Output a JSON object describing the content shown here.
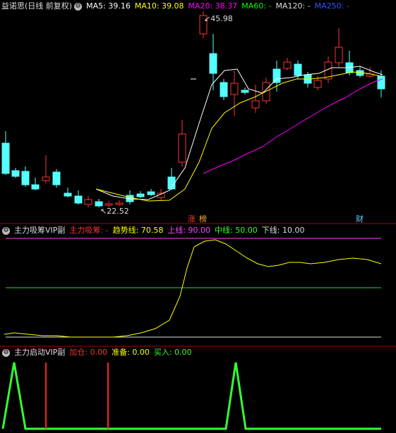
{
  "main_header": {
    "stock_name": "益诺思",
    "period": "(日线 前复权)",
    "ma5_label": "MA5:",
    "ma5_value": "39.16",
    "ma10_label": "MA10:",
    "ma10_value": "39.08",
    "ma20_label": "MA20:",
    "ma20_value": "38.37",
    "ma60_label": "MA60:",
    "ma60_value": "-",
    "ma120_label": "MA120:",
    "ma120_value": "-",
    "ma250_label": "MA250:",
    "ma250_value": "-"
  },
  "main_chart": {
    "high_label": "45.98",
    "low_label": "22.52",
    "markers": [
      {
        "text": "涨",
        "color": "#ff3333"
      },
      {
        "text": "榜",
        "color": "#ffaa33"
      },
      {
        "text": "财",
        "color": "#66ccff"
      }
    ]
  },
  "panel2_header": {
    "title": "主力吸筹VIP副",
    "xichou_label": "主力吸筹:",
    "xichou_value": "-",
    "trend_label": "趋势线:",
    "trend_value": "70.58",
    "upper_label": "上线:",
    "upper_value": "90.00",
    "mid_label": "中线:",
    "mid_value": "50.00",
    "lower_label": "下线:",
    "lower_value": "10.00"
  },
  "panel3_header": {
    "title": "主力启动VIP副",
    "add_label": "加仓:",
    "add_value": "0.00",
    "prep_label": "准备:",
    "prep_value": "0.00",
    "buy_label": "买入:",
    "buy_value": "0.00"
  },
  "colors": {
    "up": "#ff3232",
    "down": "#54ffff",
    "ma5": "#ffffff",
    "ma10": "#ffff00",
    "ma20": "#ff00ff",
    "ma120": "#ffffff",
    "ma250": "#0000ff",
    "ma60": "#00ff00",
    "panel_border": "#aa0000",
    "trend": "#ffff00"
  }
}
